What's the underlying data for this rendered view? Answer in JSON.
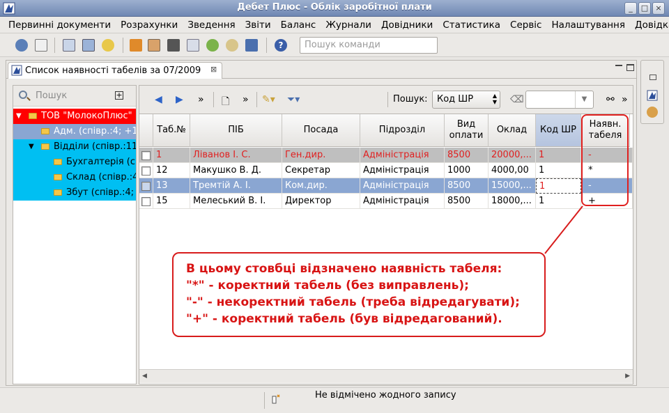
{
  "window": {
    "title": "Дебет Плюс - Облік заробітної плати",
    "controls": [
      "_",
      "□",
      "×"
    ]
  },
  "menu": [
    "Первинні документи",
    "Розрахунки",
    "Зведення",
    "Звіти",
    "Баланс",
    "Журнали",
    "Довідники",
    "Статистика",
    "Сервіс",
    "Налаштування",
    "Довідка"
  ],
  "toolbar": {
    "command_search_placeholder": "Пошук команди"
  },
  "editor_tab": {
    "label": "Список наявності табелів за 07/2009",
    "close": "⊠"
  },
  "tree": {
    "search_placeholder": "Пошук",
    "expand_all": "+",
    "items": [
      {
        "label": "ТОВ \"МолокоПлюс\"",
        "level": 0,
        "expanded": true,
        "bg": "#ff0000"
      },
      {
        "label": "Адм. (співр.:4; +1",
        "level": 1,
        "expanded": null,
        "bg": "#8aa6d2"
      },
      {
        "label": "Відділи (співр.:11",
        "level": 1,
        "expanded": true,
        "bg": "#00bff2"
      },
      {
        "label": "Бухгалтерія (с",
        "level": 2,
        "expanded": null,
        "bg": "#00bff2"
      },
      {
        "label": "Склад (співр.:4",
        "level": 2,
        "expanded": null,
        "bg": "#00bff2"
      },
      {
        "label": "Збут (співр.:4;",
        "level": 2,
        "expanded": null,
        "bg": "#00bff2"
      }
    ]
  },
  "content_toolbar": {
    "more": "»",
    "search_label": "Пошук:",
    "search_field_value": "Код ШР"
  },
  "grid": {
    "columns": [
      "Таб.№",
      "ПІБ",
      "Посада",
      "Підрозділ",
      "Вид оплати",
      "Оклад",
      "Код ШР",
      "Наявн. табеля"
    ],
    "rows": [
      {
        "tab": "1",
        "name": "Ліванов І. С.",
        "position": "Ген.дир.",
        "dept": "Адміністрація",
        "pay": "8500",
        "salary": "20000,...",
        "code": "1",
        "status": "-",
        "style": "red"
      },
      {
        "tab": "12",
        "name": "Макушко В. Д.",
        "position": "Секретар",
        "dept": "Адміністрація",
        "pay": "1000",
        "salary": "4000,00",
        "code": "1",
        "status": "*",
        "style": "normal"
      },
      {
        "tab": "13",
        "name": "Тремтій А. І.",
        "position": "Ком.дир.",
        "dept": "Адміністрація",
        "pay": "8500",
        "salary": "15000,...",
        "code": "1",
        "status": "-",
        "style": "selected"
      },
      {
        "tab": "15",
        "name": "Мелеський В. І.",
        "position": "Директор",
        "dept": "Адміністрація",
        "pay": "8500",
        "salary": "18000,...",
        "code": "1",
        "status": "+",
        "style": "normal"
      }
    ]
  },
  "callout": {
    "lines": [
      "В цьому стовбці відзначено наявність табеля:",
      "\"*\" - коректний табель (без виправлень);",
      "\"-\" - некоректний табель (треба відредагувати);",
      "\"+\" - коректний табель (був відредагований)."
    ]
  },
  "status": {
    "text": "Не відмічено жодного запису"
  },
  "colors": {
    "red_row_text": "#e02020",
    "selected_row": "#8aa6d2",
    "annotation_red": "#d81c1c"
  }
}
